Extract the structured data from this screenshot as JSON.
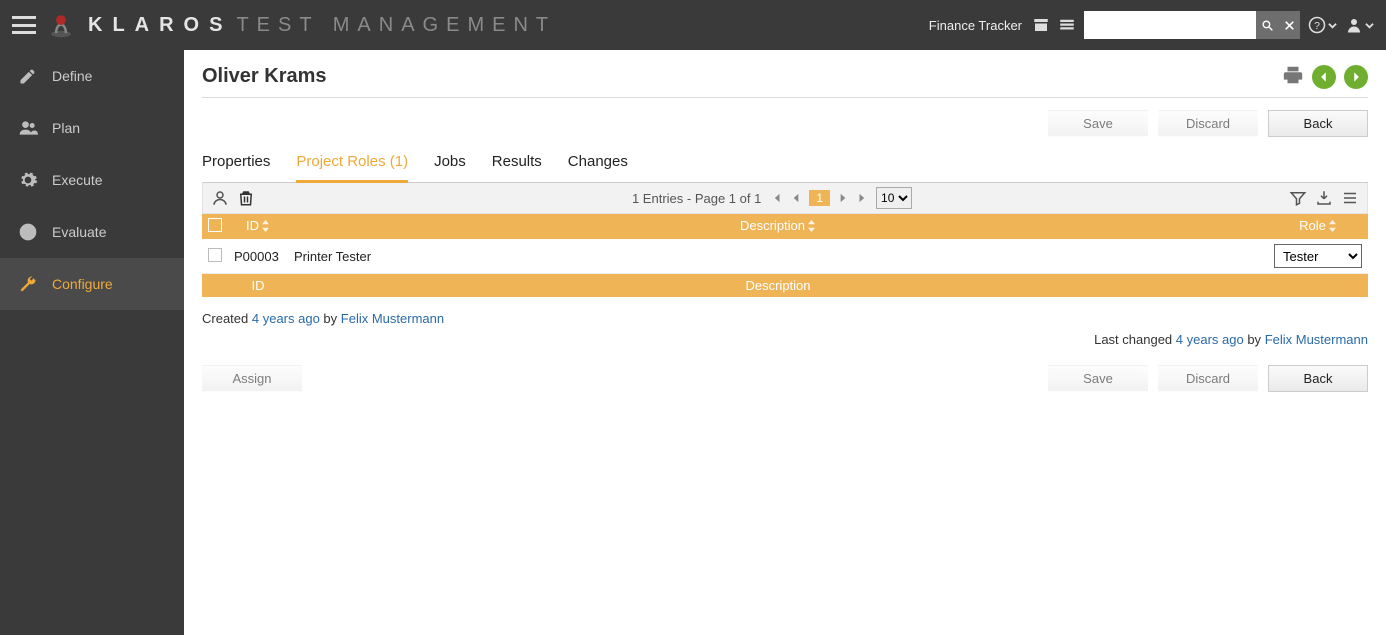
{
  "brand": {
    "main": "KLAROS",
    "sub": "TEST MANAGEMENT"
  },
  "header": {
    "context_label": "Finance Tracker"
  },
  "sidebar": {
    "items": [
      {
        "label": "Define",
        "icon": "edit"
      },
      {
        "label": "Plan",
        "icon": "users"
      },
      {
        "label": "Execute",
        "icon": "gear"
      },
      {
        "label": "Evaluate",
        "icon": "chart"
      },
      {
        "label": "Configure",
        "icon": "wrench",
        "active": true
      }
    ]
  },
  "page": {
    "title": "Oliver Krams"
  },
  "actions": {
    "save": "Save",
    "discard": "Discard",
    "back": "Back",
    "assign": "Assign"
  },
  "tabs": [
    {
      "label": "Properties"
    },
    {
      "label": "Project Roles (1)",
      "active": true
    },
    {
      "label": "Jobs"
    },
    {
      "label": "Results"
    },
    {
      "label": "Changes"
    }
  ],
  "table": {
    "paging_text": "1 Entries - Page 1 of 1",
    "current_page": "1",
    "page_size": "10",
    "columns": {
      "id": "ID",
      "description": "Description",
      "role": "Role"
    },
    "rows": [
      {
        "id": "P00003",
        "description": "Printer Tester",
        "role": "Tester"
      }
    ],
    "footer": {
      "id": "ID",
      "description": "Description"
    }
  },
  "meta": {
    "created_prefix": "Created ",
    "created_time": "4 years ago",
    "created_by_prefix": " by ",
    "created_by": "Felix Mustermann",
    "changed_prefix": "Last changed ",
    "changed_time": "4 years ago",
    "changed_by_prefix": " by ",
    "changed_by": "Felix Mustermann"
  }
}
